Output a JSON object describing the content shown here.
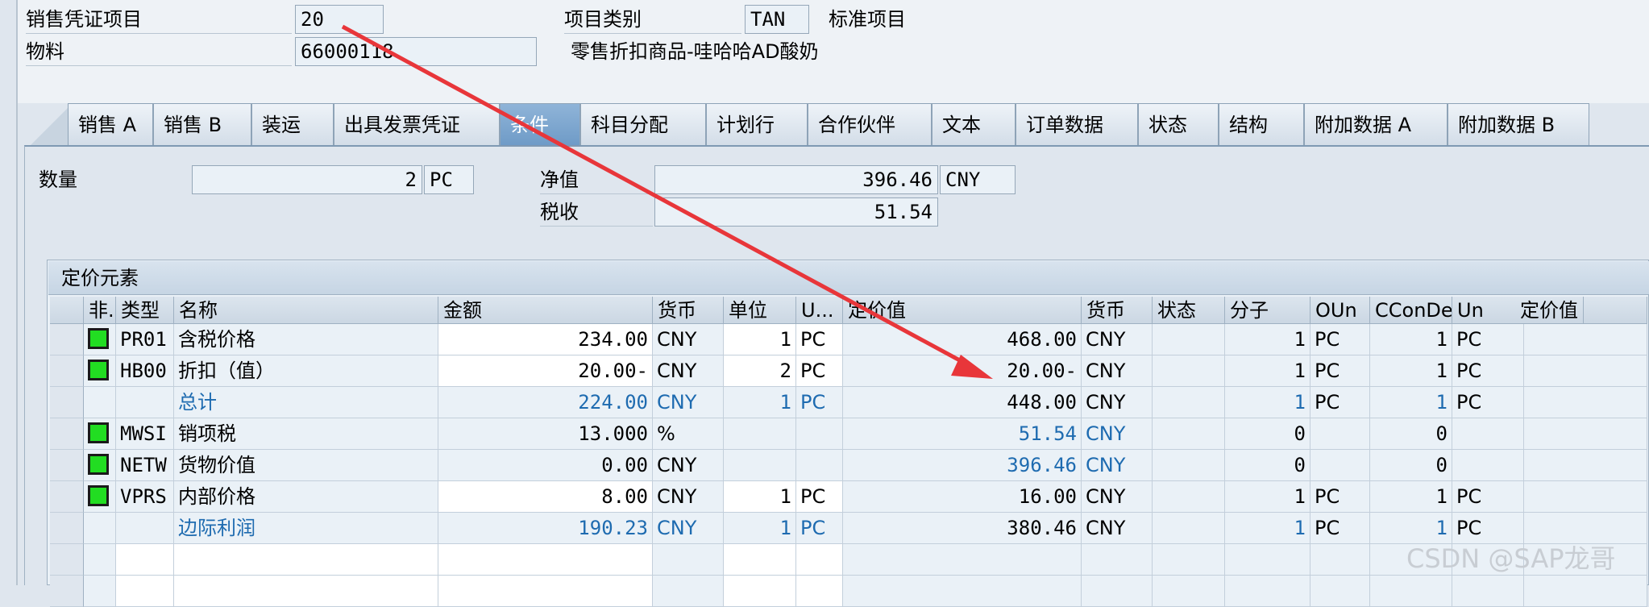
{
  "header": {
    "item_label": "销售凭证项目",
    "item_value": "20",
    "item_category_label": "项目类别",
    "item_category_value": "TAN",
    "item_category_desc": "标准项目",
    "material_label": "物料",
    "material_value": "66000118",
    "material_desc": "零售折扣商品-哇哈哈AD酸奶"
  },
  "tabs": [
    "销售 A",
    "销售 B",
    "装运",
    "出具发票凭证",
    "条件",
    "科目分配",
    "计划行",
    "合作伙伴",
    "文本",
    "订单数据",
    "状态",
    "结构",
    "附加数据 A",
    "附加数据 B"
  ],
  "active_tab": "条件",
  "summary": {
    "qty_label": "数量",
    "qty_value": "2",
    "qty_unit": "PC",
    "net_label": "净值",
    "net_value": "396.46",
    "net_currency": "CNY",
    "tax_label": "税收",
    "tax_value": "51.54"
  },
  "pricing": {
    "title": "定价元素",
    "columns": [
      "非.",
      "类型",
      "名称",
      "金额",
      "货币",
      "单位",
      "U...",
      "定价值",
      "货币",
      "状态",
      "分子",
      "OUn",
      "CConDe",
      "Un",
      "定价值"
    ],
    "rows": [
      {
        "status": true,
        "type": "PR01",
        "name": "含税价格",
        "amount": "234.00",
        "curr": "CNY",
        "per": "1",
        "uom": "PC",
        "value": "468.00",
        "vcurr": "CNY",
        "state": "",
        "num": "1",
        "oun": "PC",
        "ccon": "1",
        "un": "PC",
        "blue": false,
        "amountBlue": false,
        "valueBlue": false
      },
      {
        "status": true,
        "type": "HB00",
        "name": "折扣（值）",
        "amount": "20.00-",
        "curr": "CNY",
        "per": "2",
        "uom": "PC",
        "value": "20.00-",
        "vcurr": "CNY",
        "state": "",
        "num": "1",
        "oun": "PC",
        "ccon": "1",
        "un": "PC",
        "blue": false,
        "amountBlue": false,
        "valueBlue": false
      },
      {
        "status": false,
        "type": "",
        "name": "总计",
        "amount": "224.00",
        "curr": "CNY",
        "per": "1",
        "uom": "PC",
        "value": "448.00",
        "vcurr": "CNY",
        "state": "",
        "num": "1",
        "oun": "PC",
        "ccon": "1",
        "un": "PC",
        "blue": true,
        "amountBlue": true,
        "valueBlue": false
      },
      {
        "status": true,
        "type": "MWSI",
        "name": "销项税",
        "amount": "13.000",
        "curr": "%",
        "per": "",
        "uom": "",
        "value": "51.54",
        "vcurr": "CNY",
        "state": "",
        "num": "0",
        "oun": "",
        "ccon": "0",
        "un": "",
        "blue": false,
        "amountBlue": false,
        "valueBlue": true
      },
      {
        "status": true,
        "type": "NETW",
        "name": "货物价值",
        "amount": "0.00",
        "curr": "CNY",
        "per": "",
        "uom": "",
        "value": "396.46",
        "vcurr": "CNY",
        "state": "",
        "num": "0",
        "oun": "",
        "ccon": "0",
        "un": "",
        "blue": false,
        "amountBlue": false,
        "valueBlue": true
      },
      {
        "status": true,
        "type": "VPRS",
        "name": "内部价格",
        "amount": "8.00",
        "curr": "CNY",
        "per": "1",
        "uom": "PC",
        "value": "16.00",
        "vcurr": "CNY",
        "state": "",
        "num": "1",
        "oun": "PC",
        "ccon": "1",
        "un": "PC",
        "blue": false,
        "amountBlue": false,
        "valueBlue": false
      },
      {
        "status": false,
        "type": "",
        "name": "边际利润",
        "amount": "190.23",
        "curr": "CNY",
        "per": "1",
        "uom": "PC",
        "value": "380.46",
        "vcurr": "CNY",
        "state": "",
        "num": "1",
        "oun": "PC",
        "ccon": "1",
        "un": "PC",
        "blue": true,
        "amountBlue": true,
        "valueBlue": false
      }
    ]
  },
  "watermark": "CSDN @SAP龙哥",
  "colors": {
    "arrow": "#e8363a",
    "active_tab": "#7aa4cf",
    "status_green": "#22dd22",
    "link_blue": "#1e6bb0"
  }
}
